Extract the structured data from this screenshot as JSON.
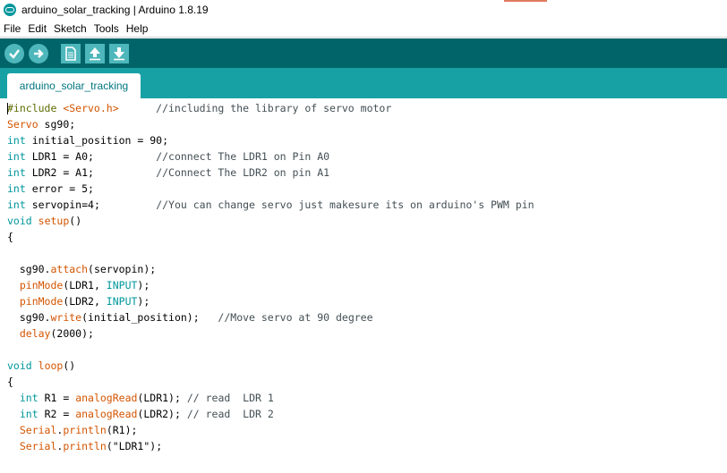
{
  "window": {
    "title": "arduino_solar_tracking | Arduino 1.8.19"
  },
  "menu": [
    "File",
    "Edit",
    "Sketch",
    "Tools",
    "Help"
  ],
  "toolbar": {
    "buttons": [
      {
        "name": "verify",
        "icon": "check-icon"
      },
      {
        "name": "upload",
        "icon": "arrow-right-icon"
      },
      {
        "name": "new",
        "icon": "new-file-icon"
      },
      {
        "name": "open",
        "icon": "arrow-up-icon"
      },
      {
        "name": "save",
        "icon": "arrow-down-icon"
      }
    ]
  },
  "tab": {
    "label": "arduino_solar_tracking"
  },
  "colors": {
    "toolbar_bg": "#006468",
    "tabbar_bg": "#17a1a5",
    "button_bg": "#4db7bb",
    "keyword": "#00979c",
    "function": "#d35400",
    "comment": "#434f54"
  },
  "code": {
    "lines": [
      [
        {
          "t": "#include ",
          "c": "inc"
        },
        {
          "t": "<Servo.h>",
          "c": "cls"
        },
        {
          "t": "      //including the library of servo motor",
          "c": "cm"
        }
      ],
      [
        {
          "t": "Servo",
          "c": "cls"
        },
        {
          "t": " sg90;",
          "c": ""
        }
      ],
      [
        {
          "t": "int",
          "c": "kw"
        },
        {
          "t": " initial_position = 90;",
          "c": ""
        }
      ],
      [
        {
          "t": "int",
          "c": "kw"
        },
        {
          "t": " LDR1 = A0;          ",
          "c": ""
        },
        {
          "t": "//connect The LDR1 on Pin A0",
          "c": "cm"
        }
      ],
      [
        {
          "t": "int",
          "c": "kw"
        },
        {
          "t": " LDR2 = A1;          ",
          "c": ""
        },
        {
          "t": "//Connect The LDR2 on pin A1",
          "c": "cm"
        }
      ],
      [
        {
          "t": "int",
          "c": "kw"
        },
        {
          "t": " error = 5;",
          "c": ""
        }
      ],
      [
        {
          "t": "int",
          "c": "kw"
        },
        {
          "t": " servopin=4;         ",
          "c": ""
        },
        {
          "t": "//You can change servo just makesure its on arduino's PWM pin",
          "c": "cm"
        }
      ],
      [
        {
          "t": "void",
          "c": "kw"
        },
        {
          "t": " ",
          "c": ""
        },
        {
          "t": "setup",
          "c": "fn"
        },
        {
          "t": "()",
          "c": ""
        }
      ],
      [
        {
          "t": "{",
          "c": ""
        }
      ],
      [
        {
          "t": "",
          "c": ""
        }
      ],
      [
        {
          "t": "  sg90.",
          "c": ""
        },
        {
          "t": "attach",
          "c": "fn"
        },
        {
          "t": "(servopin);",
          "c": ""
        }
      ],
      [
        {
          "t": "  ",
          "c": ""
        },
        {
          "t": "pinMode",
          "c": "fn"
        },
        {
          "t": "(LDR1, ",
          "c": ""
        },
        {
          "t": "INPUT",
          "c": "kw"
        },
        {
          "t": ");",
          "c": ""
        }
      ],
      [
        {
          "t": "  ",
          "c": ""
        },
        {
          "t": "pinMode",
          "c": "fn"
        },
        {
          "t": "(LDR2, ",
          "c": ""
        },
        {
          "t": "INPUT",
          "c": "kw"
        },
        {
          "t": ");",
          "c": ""
        }
      ],
      [
        {
          "t": "  sg90.",
          "c": ""
        },
        {
          "t": "write",
          "c": "fn"
        },
        {
          "t": "(initial_position);   ",
          "c": ""
        },
        {
          "t": "//Move servo at 90 degree",
          "c": "cm"
        }
      ],
      [
        {
          "t": "  ",
          "c": ""
        },
        {
          "t": "delay",
          "c": "fn"
        },
        {
          "t": "(2000);",
          "c": ""
        }
      ],
      [
        {
          "t": "",
          "c": ""
        }
      ],
      [
        {
          "t": "void",
          "c": "kw"
        },
        {
          "t": " ",
          "c": ""
        },
        {
          "t": "loop",
          "c": "fn"
        },
        {
          "t": "()",
          "c": ""
        }
      ],
      [
        {
          "t": "{",
          "c": ""
        }
      ],
      [
        {
          "t": "  ",
          "c": ""
        },
        {
          "t": "int",
          "c": "kw"
        },
        {
          "t": " R1 = ",
          "c": ""
        },
        {
          "t": "analogRead",
          "c": "fn"
        },
        {
          "t": "(LDR1); ",
          "c": ""
        },
        {
          "t": "// read  LDR 1",
          "c": "cm"
        }
      ],
      [
        {
          "t": "  ",
          "c": ""
        },
        {
          "t": "int",
          "c": "kw"
        },
        {
          "t": " R2 = ",
          "c": ""
        },
        {
          "t": "analogRead",
          "c": "fn"
        },
        {
          "t": "(LDR2); ",
          "c": ""
        },
        {
          "t": "// read  LDR 2",
          "c": "cm"
        }
      ],
      [
        {
          "t": "  ",
          "c": ""
        },
        {
          "t": "Serial",
          "c": "cls"
        },
        {
          "t": ".",
          "c": ""
        },
        {
          "t": "println",
          "c": "fn"
        },
        {
          "t": "(R1);",
          "c": ""
        }
      ],
      [
        {
          "t": "  ",
          "c": ""
        },
        {
          "t": "Serial",
          "c": "cls"
        },
        {
          "t": ".",
          "c": ""
        },
        {
          "t": "println",
          "c": "fn"
        },
        {
          "t": "(\"LDR1\");",
          "c": ""
        }
      ]
    ]
  }
}
